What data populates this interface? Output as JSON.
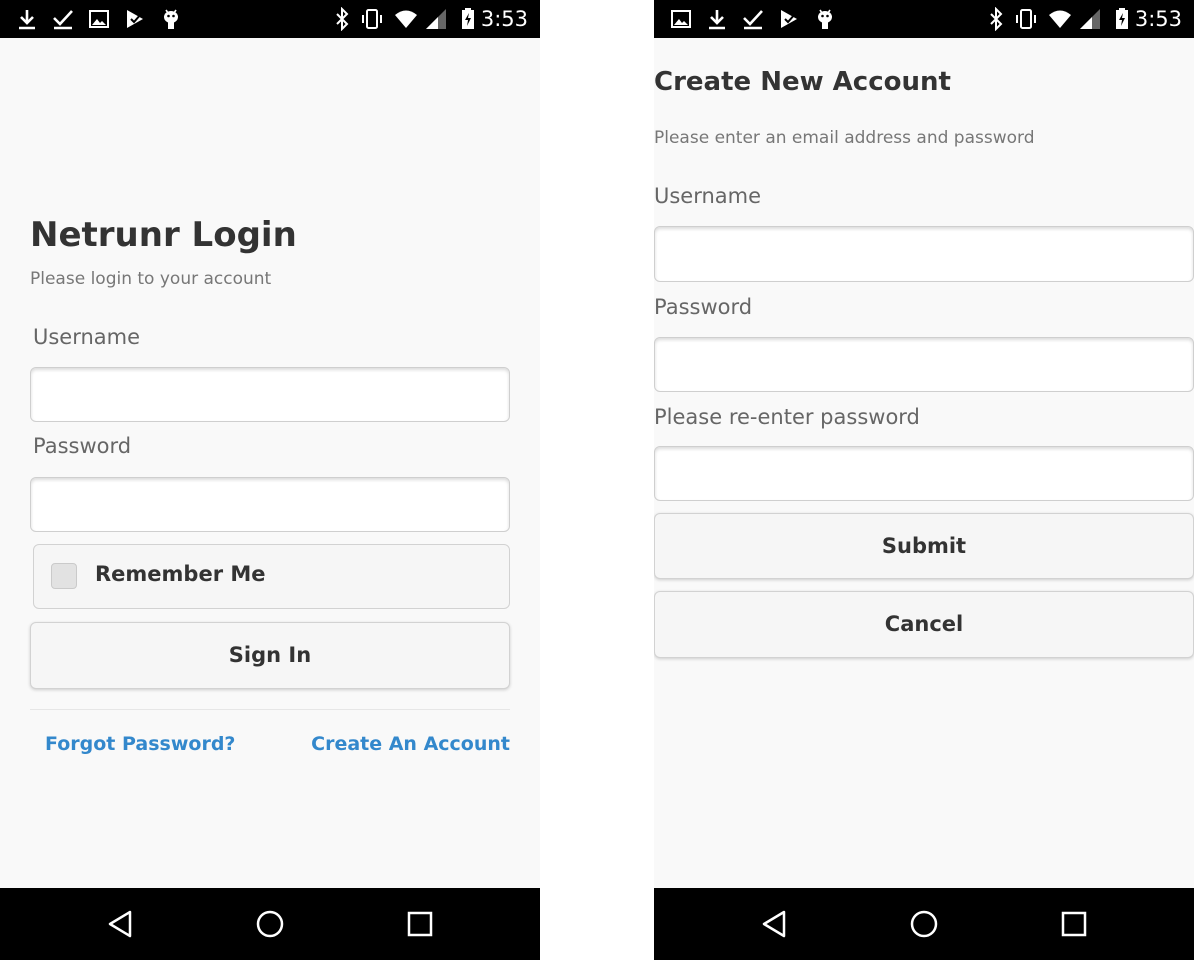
{
  "status_bar": {
    "time": "3:53",
    "left_icons_login": [
      "download-icon",
      "checkmark-icon",
      "image-icon",
      "play-store-icon",
      "android-icon"
    ],
    "left_icons_create": [
      "image-icon",
      "download-icon",
      "checkmark-icon",
      "play-store-icon",
      "android-icon"
    ],
    "right_icons": [
      "bluetooth-icon",
      "vibrate-icon",
      "wifi-icon",
      "cell-signal-icon",
      "battery-charging-icon"
    ]
  },
  "login": {
    "title": "Netrunr Login",
    "subtitle": "Please login to your account",
    "username_label": "Username",
    "username_value": "",
    "password_label": "Password",
    "password_value": "",
    "remember_label": "Remember Me",
    "remember_checked": false,
    "signin_label": "Sign In",
    "forgot_label": "Forgot Password?",
    "create_label": "Create An Account"
  },
  "create_account": {
    "title": "Create New Account",
    "subtitle": "Please enter an email address and password",
    "username_label": "Username",
    "username_value": "",
    "password_label": "Password",
    "password_value": "",
    "reenter_label": "Please re-enter password",
    "reenter_value": "",
    "submit_label": "Submit",
    "cancel_label": "Cancel"
  },
  "nav_bar": {
    "buttons": [
      "back-icon",
      "home-icon",
      "recents-icon"
    ]
  },
  "colors": {
    "link": "#3388cc",
    "background": "#f9f9f9",
    "bars": "#000000"
  }
}
